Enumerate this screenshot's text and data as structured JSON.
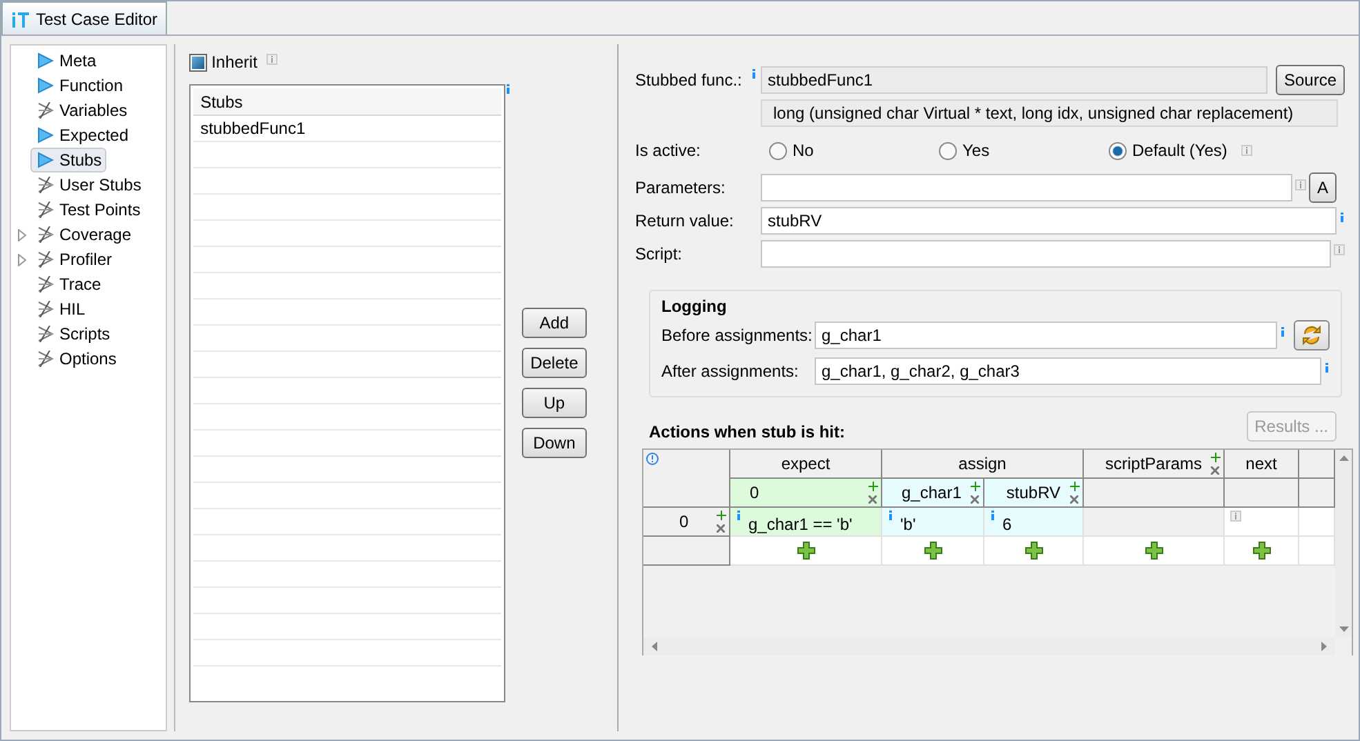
{
  "tab": {
    "title": "Test Case Editor",
    "selected": true
  },
  "tree": [
    {
      "label": "Meta",
      "kind": "active",
      "selected": false,
      "expandable": false
    },
    {
      "label": "Function",
      "kind": "active",
      "selected": false,
      "expandable": false
    },
    {
      "label": "Variables",
      "kind": "inactive",
      "selected": false,
      "expandable": false
    },
    {
      "label": "Expected",
      "kind": "active",
      "selected": false,
      "expandable": false
    },
    {
      "label": "Stubs",
      "kind": "active",
      "selected": true,
      "expandable": false
    },
    {
      "label": "User Stubs",
      "kind": "inactive",
      "selected": false,
      "expandable": false
    },
    {
      "label": "Test Points",
      "kind": "inactive",
      "selected": false,
      "expandable": false
    },
    {
      "label": "Coverage",
      "kind": "inactive",
      "selected": false,
      "expandable": true
    },
    {
      "label": "Profiler",
      "kind": "inactive",
      "selected": false,
      "expandable": true
    },
    {
      "label": "Trace",
      "kind": "inactive",
      "selected": false,
      "expandable": false
    },
    {
      "label": "HIL",
      "kind": "inactive",
      "selected": false,
      "expandable": false
    },
    {
      "label": "Scripts",
      "kind": "inactive",
      "selected": false,
      "expandable": false
    },
    {
      "label": "Options",
      "kind": "inactive",
      "selected": false,
      "expandable": false
    }
  ],
  "inherit": {
    "label": "Inherit",
    "checked": true
  },
  "stubs_list": {
    "column": "Stubs",
    "rows": [
      "stubbedFunc1"
    ]
  },
  "list_buttons": [
    "Add",
    "Delete",
    "Up",
    "Down"
  ],
  "form": {
    "stubbed_func": {
      "label": "Stubbed func.:",
      "value": "stubbedFunc1",
      "button": "Source"
    },
    "signature": "long (unsigned char Virtual * text, long idx, unsigned char replacement)",
    "is_active": {
      "label": "Is active:",
      "options": [
        {
          "label": "No",
          "selected": false
        },
        {
          "label": "Yes",
          "selected": false
        },
        {
          "label": "Default (Yes)",
          "selected": true
        }
      ]
    },
    "parameters": {
      "label": "Parameters:",
      "button": "A"
    },
    "return_value": {
      "label": "Return value:",
      "value": "stubRV"
    },
    "script": {
      "label": "Script:"
    }
  },
  "logging": {
    "title": "Logging",
    "before": {
      "label": "Before assignments:",
      "value": "g_char1"
    },
    "after": {
      "label": "After assignments:",
      "value": "g_char1, g_char2, g_char3"
    }
  },
  "actions": {
    "title": "Actions when stub is hit:",
    "results_button": {
      "label": "Results ...",
      "disabled": true
    }
  },
  "table": {
    "groups": [
      {
        "label": "expect",
        "kind": "expect",
        "columns": [
          "0"
        ]
      },
      {
        "label": "assign",
        "kind": "assign",
        "columns": [
          "g_char1",
          "stubRV"
        ]
      },
      {
        "label": "scriptParams",
        "kind": "plain"
      },
      {
        "label": "next",
        "kind": "plain"
      }
    ],
    "rows": [
      {
        "label": "0",
        "cells": [
          "g_char1 == 'b'",
          "'b'",
          "6",
          null,
          null
        ]
      }
    ]
  }
}
